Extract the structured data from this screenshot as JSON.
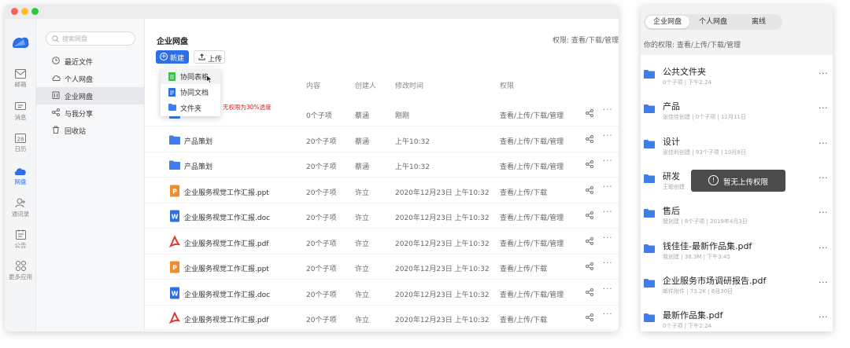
{
  "desktop": {
    "window_dots": {
      "red": "#ff5f57",
      "yellow": "#febc2e",
      "green": "#28c840"
    },
    "appbar": {
      "logo": "cloud-logo-icon",
      "items": [
        {
          "label": "邮箱",
          "icon": "mail-icon"
        },
        {
          "label": "消息",
          "icon": "message-icon"
        },
        {
          "label": "日历",
          "icon": "calendar-icon"
        },
        {
          "label": "网盘",
          "icon": "cloud-drive-icon",
          "active": true
        },
        {
          "label": "通讯录",
          "icon": "contacts-icon"
        },
        {
          "label": "公告",
          "icon": "notice-icon"
        },
        {
          "label": "更多应用",
          "icon": "apps-icon"
        }
      ]
    },
    "sidebar": {
      "search_placeholder": "搜索网盘",
      "items": [
        {
          "label": "最近文件",
          "icon": "clock-icon"
        },
        {
          "label": "个人网盘",
          "icon": "cloud-icon"
        },
        {
          "label": "企业网盘",
          "icon": "building-icon",
          "active": true
        },
        {
          "label": "与我分享",
          "icon": "share-icon"
        },
        {
          "label": "回收站",
          "icon": "trash-icon"
        }
      ]
    },
    "main": {
      "title": "企业网盘",
      "permission": "权限: 查看/下载/管理",
      "new_button": "新建",
      "upload_button": "上传",
      "columns": {
        "content": "内容",
        "creator": "创建人",
        "modified": "修改时间",
        "permission": "权限"
      },
      "dropdown": [
        {
          "label": "协同表格",
          "icon": "sheet-icon",
          "color": "#3fb950"
        },
        {
          "label": "协同文档",
          "icon": "doc-icon",
          "color": "#2e6fe6"
        },
        {
          "label": "文件夹",
          "icon": "folder-icon",
          "color": "#3f7ee8"
        }
      ],
      "no_permission_tip": "无权限为30%透度",
      "rows": [
        {
          "name": "",
          "type": "folder",
          "content": "0个子项",
          "creator": "蔡涵",
          "modified": "刚刚",
          "permission": "查看/上传/下载/管理"
        },
        {
          "name": "产品策划",
          "type": "folder",
          "content": "20个子项",
          "creator": "蔡涵",
          "modified": "上午10:32",
          "permission": "查看/上传/下载/管理"
        },
        {
          "name": "产品策划",
          "type": "folder",
          "content": "20个子项",
          "creator": "蔡涵",
          "modified": "上午10:32",
          "permission": "查看/上传/下载/管理"
        },
        {
          "name": "企业服务视觉工作汇报.ppt",
          "type": "ppt",
          "content": "20个子项",
          "creator": "许立",
          "modified": "2020年12月23日 上午10:32",
          "permission": "查看/上传/下载"
        },
        {
          "name": "企业服务视觉工作汇报.doc",
          "type": "doc",
          "content": "20个子项",
          "creator": "许立",
          "modified": "2020年12月23日 上午10:32",
          "permission": "查看/上传/下载/管理"
        },
        {
          "name": "企业服务视觉工作汇报.pdf",
          "type": "pdf",
          "content": "20个子项",
          "creator": "许立",
          "modified": "2020年12月23日 上午10:32",
          "permission": "查看/上传/下载/管理"
        },
        {
          "name": "企业服务视觉工作汇报.ppt",
          "type": "ppt",
          "content": "20个子项",
          "creator": "许立",
          "modified": "2020年12月23日 上午10:32",
          "permission": "查看/上传/下载"
        },
        {
          "name": "企业服务视觉工作汇报.doc",
          "type": "doc",
          "content": "20个子项",
          "creator": "许立",
          "modified": "2020年12月23日 上午10:32",
          "permission": "查看/上传/下载/管理"
        },
        {
          "name": "企业服务视觉工作汇报.pdf",
          "type": "pdf",
          "content": "20个子项",
          "creator": "许立",
          "modified": "2020年12月23日 上午10:32",
          "permission": "查看/上传/下载"
        }
      ]
    }
  },
  "mobile": {
    "tabs": [
      {
        "label": "企业网盘",
        "active": true
      },
      {
        "label": "个人网盘"
      },
      {
        "label": "离线"
      }
    ],
    "permission": "你的权限: 查看/上传/下载/管理",
    "items": [
      {
        "name": "公共文件夹",
        "sub": "0个子项 | 下午2:24"
      },
      {
        "name": "产品",
        "sub": "张佳佳创建 | 0个子项 | 11月11日"
      },
      {
        "name": "设计",
        "sub": "张佳利创建 | 93个子项 | 10月8日"
      },
      {
        "name": "研发",
        "sub": "王聪创建"
      },
      {
        "name": "售后",
        "sub": "我创建 | 8个子项 | 2019年4月3日"
      },
      {
        "name": "钱佳佳-最新作品集.pdf",
        "sub": "我创建 | 38.3M | 下午3:45"
      },
      {
        "name": "企业服务市场调研报告.pdf",
        "sub": "邮件附件 | 73.2K | 8月30日"
      },
      {
        "name": "最新作品集.pdf",
        "sub": "0个子项 | 下午2:24"
      }
    ],
    "toast": "暂无上传权限"
  },
  "colors": {
    "accent": "#2e6fe6",
    "folder": "#3f7ee8",
    "ppt": "#f08c2e",
    "doc": "#2e6fe6",
    "pdf": "#e0382f",
    "sheet": "#3fb950"
  }
}
